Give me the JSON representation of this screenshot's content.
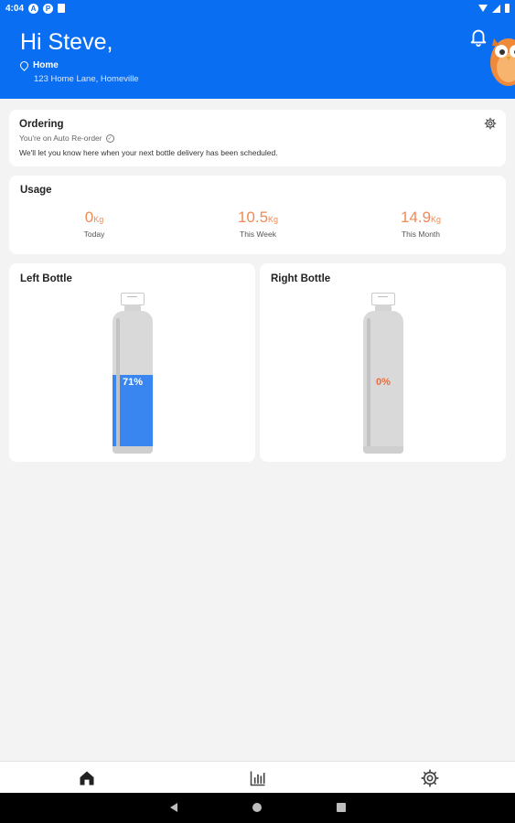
{
  "status_bar": {
    "time": "4:04",
    "icon_a": "A",
    "icon_p": "P"
  },
  "header": {
    "greeting": "Hi Steve,",
    "location_label": "Home",
    "address": "123 Home Lane, Homeville",
    "bell": "bell-icon",
    "background_color": "#0a6ef2"
  },
  "ordering": {
    "title": "Ordering",
    "status": "You're on Auto Re-order",
    "message": "We'll let you know here when your next bottle delivery has been scheduled."
  },
  "usage": {
    "title": "Usage",
    "items": [
      {
        "value": "0",
        "unit": "Kg",
        "caption": "Today"
      },
      {
        "value": "10.5",
        "unit": "Kg",
        "caption": "This Week"
      },
      {
        "value": "14.9",
        "unit": "Kg",
        "caption": "This Month"
      }
    ],
    "accent_color": "#ef8a55"
  },
  "bottles": {
    "left": {
      "title": "Left Bottle",
      "percent_label": "71%",
      "fill_fraction": 0.71
    },
    "right": {
      "title": "Right Bottle",
      "percent_label": "0%",
      "fill_fraction": 0
    }
  },
  "bottom_nav": {
    "items": [
      "home-icon",
      "stats-icon",
      "settings-icon"
    ]
  }
}
